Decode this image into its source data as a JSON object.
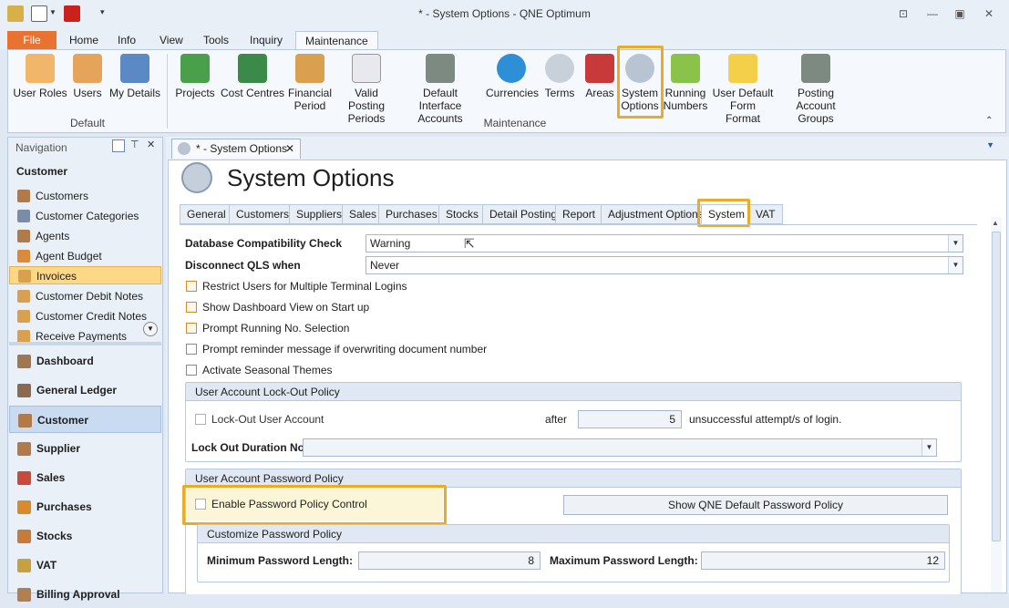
{
  "window": {
    "title": "* - System Options - QNE Optimum"
  },
  "ribbon_tabs": [
    {
      "label": "File"
    },
    {
      "label": "Home"
    },
    {
      "label": "Info"
    },
    {
      "label": "View"
    },
    {
      "label": "Tools"
    },
    {
      "label": "Inquiry"
    },
    {
      "label": "Maintenance"
    }
  ],
  "ribbon": {
    "groups": [
      {
        "label": "Default"
      },
      {
        "label": "Maintenance"
      }
    ],
    "buttons": [
      {
        "label": "User Roles",
        "icon": "user-roles-icon"
      },
      {
        "label": "Users",
        "icon": "users-icon"
      },
      {
        "label": "My Details",
        "icon": "my-details-icon"
      },
      {
        "label": "Projects",
        "icon": "projects-icon"
      },
      {
        "label": "Cost Centres",
        "icon": "cost-centres-icon"
      },
      {
        "label": "Financial Period",
        "icon": "financial-period-icon"
      },
      {
        "label": "Valid Posting Periods",
        "icon": "calendar-icon"
      },
      {
        "label": "Default Interface Accounts",
        "icon": "ledger-book-icon"
      },
      {
        "label": "Currencies",
        "icon": "dollar-icon"
      },
      {
        "label": "Terms",
        "icon": "clock-icon"
      },
      {
        "label": "Areas",
        "icon": "flag-icon"
      },
      {
        "label": "System Options",
        "icon": "gears-icon"
      },
      {
        "label": "Running Numbers",
        "icon": "pencil-icon"
      },
      {
        "label": "User Default Form Format",
        "icon": "form-format-icon"
      },
      {
        "label": "Posting Account Groups",
        "icon": "ledger-book-icon"
      }
    ]
  },
  "navigation": {
    "title": "Navigation",
    "section": "Customer",
    "items": [
      {
        "label": "Customers"
      },
      {
        "label": "Customer Categories"
      },
      {
        "label": "Agents"
      },
      {
        "label": "Agent Budget"
      },
      {
        "label": "Invoices"
      },
      {
        "label": "Customer Debit Notes"
      },
      {
        "label": "Customer Credit Notes"
      },
      {
        "label": "Receive Payments"
      }
    ],
    "modules": [
      {
        "label": "Dashboard"
      },
      {
        "label": "General Ledger"
      },
      {
        "label": "Customer"
      },
      {
        "label": "Supplier"
      },
      {
        "label": "Sales"
      },
      {
        "label": "Purchases"
      },
      {
        "label": "Stocks"
      },
      {
        "label": "VAT"
      },
      {
        "label": "Billing Approval"
      }
    ]
  },
  "document": {
    "tab_label": "* - System Options",
    "heading": "System Options",
    "option_tabs": [
      {
        "label": "General"
      },
      {
        "label": "Customers"
      },
      {
        "label": "Suppliers"
      },
      {
        "label": "Sales"
      },
      {
        "label": "Purchases"
      },
      {
        "label": "Stocks"
      },
      {
        "label": "Detail Posting"
      },
      {
        "label": "Report"
      },
      {
        "label": "Adjustment Options"
      },
      {
        "label": "System"
      },
      {
        "label": "VAT"
      }
    ],
    "fields": {
      "db_compat_label": "Database Compatibility Check",
      "db_compat_value": "Warning",
      "disconnect_label": "Disconnect QLS when",
      "disconnect_value": "Never"
    },
    "checkboxes": [
      {
        "label": "Restrict Users for Multiple Terminal Logins",
        "checked": false
      },
      {
        "label": "Show Dashboard View on Start up",
        "checked": false
      },
      {
        "label": "Prompt Running No. Selection",
        "checked": false
      },
      {
        "label": "Prompt reminder message if overwriting document number",
        "checked": false
      },
      {
        "label": "Activate Seasonal Themes",
        "checked": false
      }
    ],
    "lockout": {
      "title": "User Account Lock-Out Policy",
      "checkbox_label": "Lock-Out User Account",
      "after_label": "after",
      "attempts_value": "5",
      "attempts_suffix": "unsuccessful attempt/s of login.",
      "duration_label": "Lock Out Duration No"
    },
    "password": {
      "title": "User Account Password Policy",
      "enable_label": "Enable Password Policy Control",
      "default_button": "Show QNE Default Password Policy",
      "customize_title": "Customize Password Policy",
      "min_label": "Minimum Password Length:",
      "min_value": "8",
      "max_label": "Maximum Password Length:",
      "max_value": "12"
    }
  },
  "colors": {
    "accent_file": "#e8722f",
    "highlight": "#e7ad2a",
    "selection": "#fcd887"
  }
}
